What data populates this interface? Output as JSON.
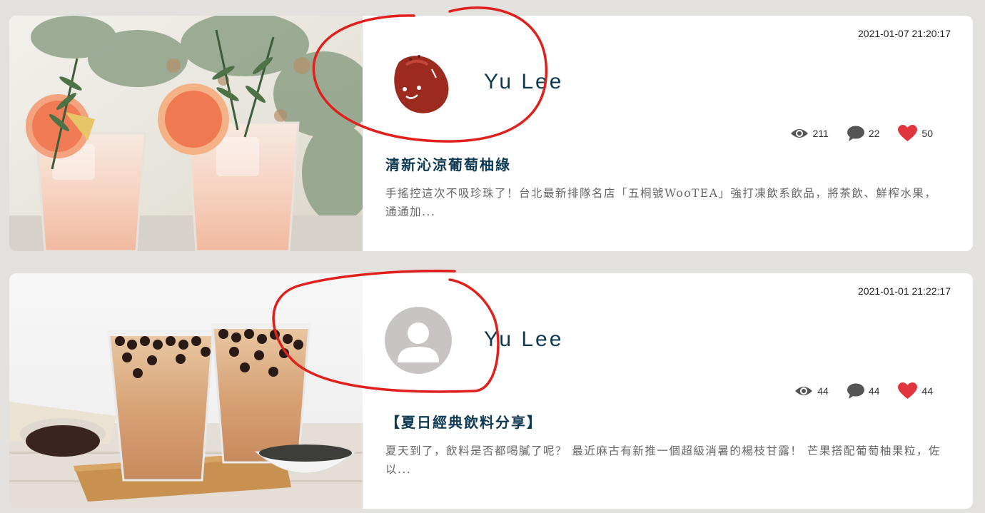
{
  "posts": [
    {
      "date": "2021-01-07 21:20:17",
      "author": "Yu Lee",
      "avatar_icon": "red-bean-character-icon",
      "views": "211",
      "comments": "22",
      "likes": "50",
      "title": "清新沁涼葡萄柚綠",
      "excerpt": "手搖控這次不吸珍珠了！台北最新排隊名店「五桐號WooTEA」強打凍飲系飲品，將茶飲、鮮榨水果，通通加..."
    },
    {
      "date": "2021-01-01 21:22:17",
      "author": "Yu Lee",
      "avatar_icon": "default-user-icon",
      "views": "44",
      "comments": "44",
      "likes": "44",
      "title": "【夏日經典飲料分享】",
      "excerpt": "夏天到了，飲料是否都喝膩了呢？ 最近麻古有新推一個超級消暑的楊枝甘露！ 芒果搭配葡萄柚果粒，佐以..."
    }
  ],
  "colors": {
    "page_bg": "#e3e1dd",
    "title": "#0d3a52",
    "heart": "#e0343e",
    "annotation": "#e0201c"
  }
}
